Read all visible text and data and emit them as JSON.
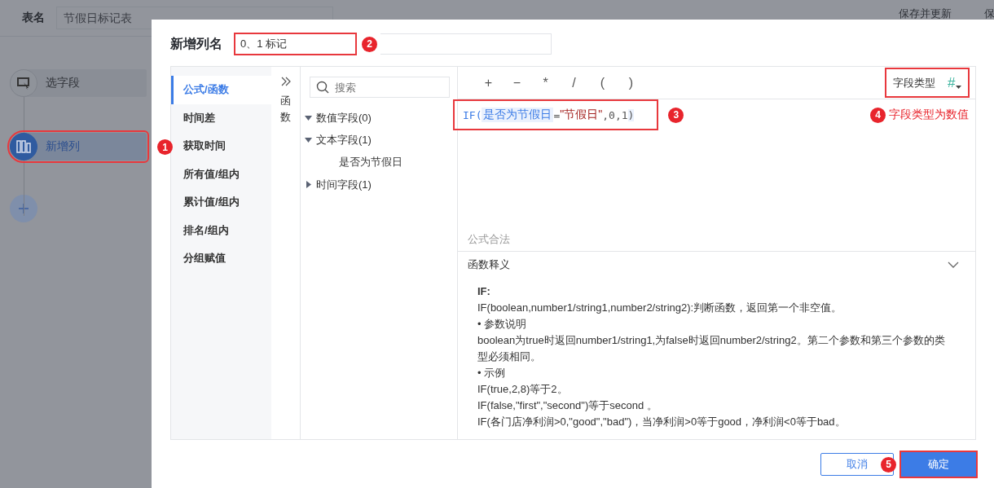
{
  "page": {
    "table_name_label": "表名",
    "table_name_value": "节假日标记表",
    "save_buttons": [
      "保存并更新",
      "保"
    ],
    "steps": [
      {
        "label": "选字段",
        "kind": "select",
        "selected": false,
        "highlight": false
      },
      {
        "label": "新增列",
        "kind": "column",
        "selected": true,
        "highlight": true
      }
    ]
  },
  "dialog": {
    "title": "新增列名",
    "name_value": "0、1 标记",
    "name_highlight": true,
    "name_marker": "2",
    "menu": [
      {
        "label": "公式/函数",
        "selected": true
      },
      {
        "label": "时间差",
        "selected": false
      },
      {
        "label": "获取时间",
        "selected": false
      },
      {
        "label": "所有值/组内",
        "selected": false
      },
      {
        "label": "累计值/组内",
        "selected": false
      },
      {
        "label": "排名/组内",
        "selected": false
      },
      {
        "label": "分组赋值",
        "selected": false
      }
    ],
    "menu_marker": "1",
    "function_toggle": "函数",
    "search": {
      "placeholder": "搜索"
    },
    "field_tree": [
      {
        "label": "数值字段(0)",
        "expanded": true
      },
      {
        "label": "文本字段(1)",
        "expanded": true,
        "children": [
          {
            "label": "是否为节假日"
          }
        ]
      },
      {
        "label": "时间字段(1)",
        "expanded": false
      }
    ],
    "operators": [
      "+",
      "−",
      "*",
      "/",
      "(",
      ")"
    ],
    "field_type": {
      "label": "字段类型",
      "symbol": "#",
      "highlight": true
    },
    "formula": [
      {
        "kind": "func",
        "text": "IF("
      },
      {
        "kind": "field",
        "text": "是否为节假日"
      },
      {
        "kind": "plain",
        "text": "="
      },
      {
        "kind": "string",
        "text": "\"节假日\""
      },
      {
        "kind": "plain",
        "text": ",0,1"
      },
      {
        "kind": "close",
        "text": ")"
      }
    ],
    "formula_highlight": true,
    "formula_marker": "3",
    "type_marker": "4",
    "type_note": "字段类型为数值",
    "status": "公式合法",
    "explain": {
      "title": "函数释义",
      "expanded": true,
      "lines": [
        {
          "kind": "heading",
          "text": "IF:"
        },
        {
          "kind": "text",
          "text": "IF(boolean,number1/string1,number2/string2):判断函数，返回第一个非空值。"
        },
        {
          "kind": "text",
          "text": "• 参数说明"
        },
        {
          "kind": "text",
          "text": "boolean为true时返回number1/string1,为false时返回number2/string2。第二个参数和第三个参数的类型必须相同。"
        },
        {
          "kind": "text",
          "text": "• 示例"
        },
        {
          "kind": "text",
          "text": "IF(true,2,8)等于2。"
        },
        {
          "kind": "text",
          "text": "IF(false,\"first\",\"second\")等于second 。"
        },
        {
          "kind": "text",
          "text": "IF(各门店净利润>0,\"good\",\"bad\")，当净利润>0等于good，净利润<0等于bad。"
        }
      ]
    },
    "cancel": "取消",
    "ok": "确定",
    "ok_highlight": true,
    "ok_marker": "5"
  }
}
